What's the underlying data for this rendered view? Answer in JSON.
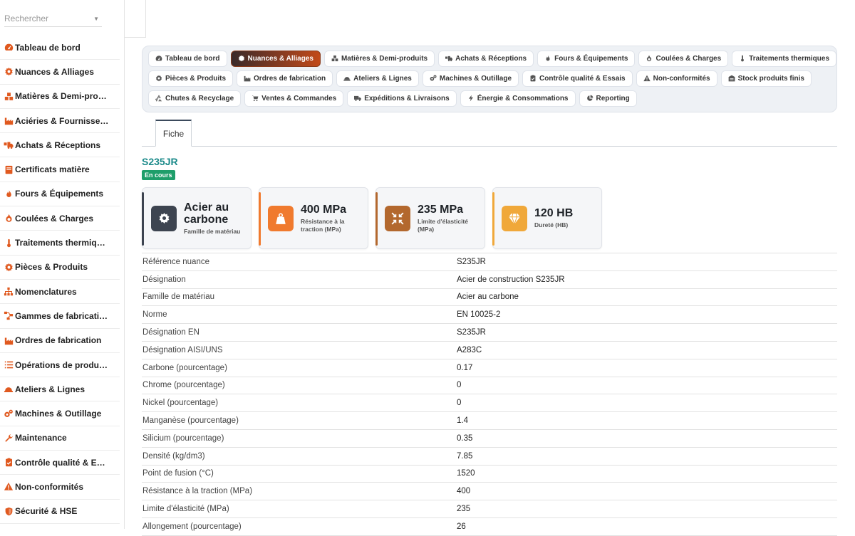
{
  "sidebar": {
    "search_placeholder": "Rechercher",
    "items": [
      {
        "label": "Tableau de bord",
        "icon": "dashboard-icon",
        "color": "#e0591f"
      },
      {
        "label": "Nuances & Alliages",
        "icon": "gear-icon",
        "color": "#e0591f"
      },
      {
        "label": "Matières & Demi-pro…",
        "icon": "cubes-icon",
        "color": "#e0591f"
      },
      {
        "label": "Aciéries & Fournisse…",
        "icon": "factory-icon",
        "color": "#e0591f"
      },
      {
        "label": "Achats & Réceptions",
        "icon": "truck-loading-icon",
        "color": "#e0591f"
      },
      {
        "label": "Certificats matière",
        "icon": "certificate-icon",
        "color": "#e0591f"
      },
      {
        "label": "Fours & Équipements",
        "icon": "fire-icon",
        "color": "#e0591f"
      },
      {
        "label": "Coulées & Charges",
        "icon": "burn-icon",
        "color": "#e0591f"
      },
      {
        "label": "Traitements thermiq…",
        "icon": "thermometer-icon",
        "color": "#e0591f"
      },
      {
        "label": "Pièces & Produits",
        "icon": "cog-icon",
        "color": "#e0591f"
      },
      {
        "label": "Nomenclatures",
        "icon": "sitemap-icon",
        "color": "#e0591f"
      },
      {
        "label": "Gammes de fabricati…",
        "icon": "project-diagram-icon",
        "color": "#e0591f"
      },
      {
        "label": "Ordres de fabrication",
        "icon": "industry-icon",
        "color": "#e0591f"
      },
      {
        "label": "Opérations de produ…",
        "icon": "list-icon",
        "color": "#e0591f"
      },
      {
        "label": "Ateliers & Lignes",
        "icon": "hard-hat-icon",
        "color": "#e0591f"
      },
      {
        "label": "Machines & Outillage",
        "icon": "cogs-icon",
        "color": "#e0591f"
      },
      {
        "label": "Maintenance",
        "icon": "wrench-icon",
        "color": "#e0591f"
      },
      {
        "label": "Contrôle qualité & E…",
        "icon": "clipboard-check-icon",
        "color": "#e0591f"
      },
      {
        "label": "Non-conformités",
        "icon": "warning-icon",
        "color": "#e0591f"
      },
      {
        "label": "Sécurité & HSE",
        "icon": "shield-icon",
        "color": "#e0591f"
      }
    ]
  },
  "modules": {
    "rows": [
      [
        {
          "label": "Tableau de bord",
          "icon": "dashboard-icon",
          "active": false
        },
        {
          "label": "Nuances & Alliages",
          "icon": "gear-icon",
          "active": true
        },
        {
          "label": "Matières & Demi-produits",
          "icon": "cubes-icon",
          "active": false
        },
        {
          "label": "Achats & Réceptions",
          "icon": "truck-loading-icon",
          "active": false
        },
        {
          "label": "Fours & Équipements",
          "icon": "fire-icon",
          "active": false
        },
        {
          "label": "Coulées & Charges",
          "icon": "burn-icon",
          "active": false
        },
        {
          "label": "Traitements thermiques",
          "icon": "thermometer-icon",
          "active": false
        }
      ],
      [
        {
          "label": "Pièces & Produits",
          "icon": "cog-icon",
          "active": false
        },
        {
          "label": "Ordres de fabrication",
          "icon": "industry-icon",
          "active": false
        },
        {
          "label": "Ateliers & Lignes",
          "icon": "hard-hat-icon",
          "active": false
        },
        {
          "label": "Machines & Outillage",
          "icon": "cogs-icon",
          "active": false
        },
        {
          "label": "Contrôle qualité & Essais",
          "icon": "clipboard-check-icon",
          "active": false
        },
        {
          "label": "Non-conformités",
          "icon": "warning-icon",
          "active": false
        },
        {
          "label": "Stock produits finis",
          "icon": "warehouse-icon",
          "active": false
        }
      ],
      [
        {
          "label": "Chutes & Recyclage",
          "icon": "recycle-icon",
          "active": false
        },
        {
          "label": "Ventes & Commandes",
          "icon": "cart-icon",
          "active": false
        },
        {
          "label": "Expéditions & Livraisons",
          "icon": "shipping-icon",
          "active": false
        },
        {
          "label": "Énergie & Consommations",
          "icon": "bolt-icon",
          "active": false
        },
        {
          "label": "Reporting",
          "icon": "pie-chart-icon",
          "active": false
        }
      ]
    ]
  },
  "record": {
    "tab": "Fiche",
    "title": "S235JR",
    "status": "En cours"
  },
  "kpis": [
    {
      "value": "Acier au carbone",
      "label": "Famille de matériau",
      "icon": "gear-icon",
      "color": "#3d4450",
      "accent": "#3d4450"
    },
    {
      "value": "400 MPa",
      "label": "Résistance à la traction (MPa)",
      "icon": "weight-icon",
      "color": "#f07a2e",
      "accent": "#f07a2e"
    },
    {
      "value": "235 MPa",
      "label": "Limite d'élasticité (MPa)",
      "icon": "compress-icon",
      "color": "#b3682e",
      "accent": "#b3682e"
    },
    {
      "value": "120 HB",
      "label": "Dureté (HB)",
      "icon": "gem-icon",
      "color": "#f0a83a",
      "accent": "#f0a83a"
    }
  ],
  "fields": [
    {
      "key": "Référence nuance",
      "value": "S235JR"
    },
    {
      "key": "Désignation",
      "value": "Acier de construction S235JR"
    },
    {
      "key": "Famille de matériau",
      "value": "Acier au carbone"
    },
    {
      "key": "Norme",
      "value": "EN 10025-2"
    },
    {
      "key": "Désignation EN",
      "value": "S235JR"
    },
    {
      "key": "Désignation AISI/UNS",
      "value": "A283C"
    },
    {
      "key": "Carbone (pourcentage)",
      "value": "0.17"
    },
    {
      "key": "Chrome (pourcentage)",
      "value": "0"
    },
    {
      "key": "Nickel (pourcentage)",
      "value": "0"
    },
    {
      "key": "Manganèse (pourcentage)",
      "value": "1.4"
    },
    {
      "key": "Silicium (pourcentage)",
      "value": "0.35"
    },
    {
      "key": "Densité (kg/dm3)",
      "value": "7.85"
    },
    {
      "key": "Point de fusion (°C)",
      "value": "1520"
    },
    {
      "key": "Résistance à la traction (MPa)",
      "value": "400"
    },
    {
      "key": "Limite d'élasticité (MPa)",
      "value": "235"
    },
    {
      "key": "Allongement (pourcentage)",
      "value": "26"
    }
  ]
}
